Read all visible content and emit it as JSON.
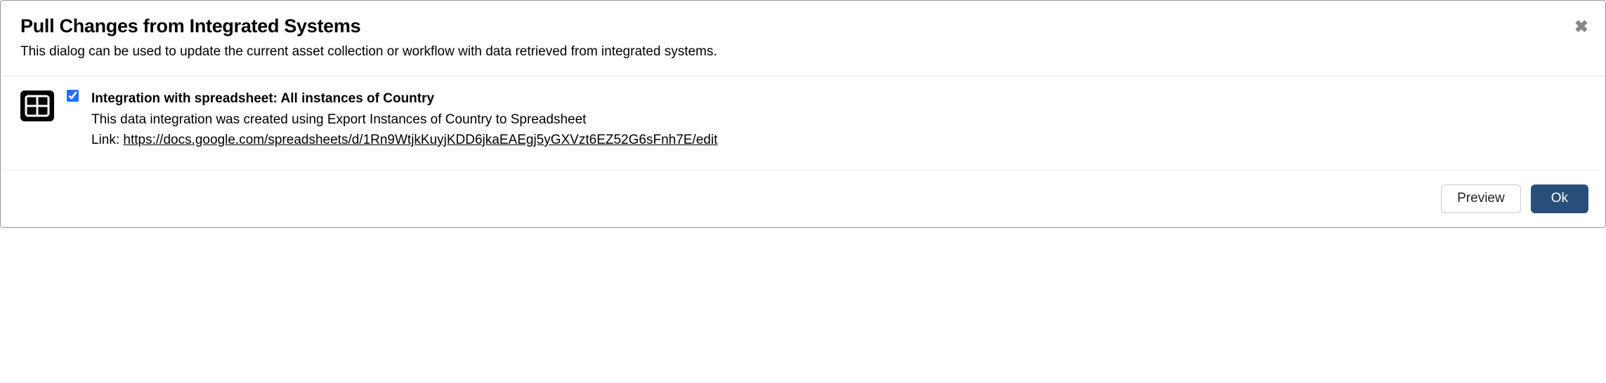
{
  "header": {
    "title": "Pull Changes from Integrated Systems",
    "subtitle": "This dialog can be used to update the current asset collection or workflow with data retrieved from integrated systems."
  },
  "integration": {
    "title": "Integration with spreadsheet: All instances of Country",
    "description": "This data integration was created using Export Instances of Country to Spreadsheet",
    "link_label": "Link: ",
    "link_url": "https://docs.google.com/spreadsheets/d/1Rn9WtjkKuyjKDD6jkaEAEgj5yGXVzt6EZ52G6sFnh7E/edit"
  },
  "footer": {
    "preview": "Preview",
    "ok": "Ok"
  }
}
